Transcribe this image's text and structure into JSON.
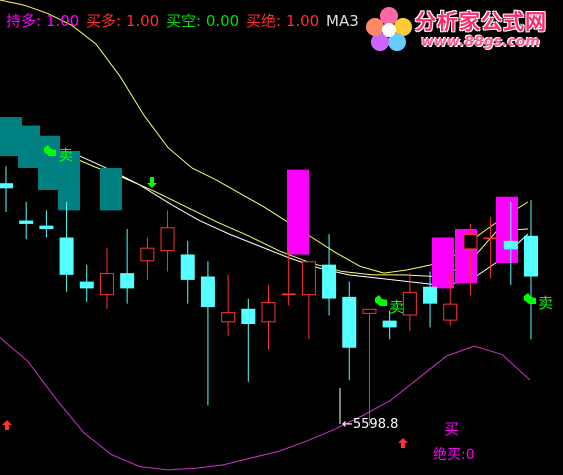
{
  "header": {
    "items": [
      {
        "label": "持多:",
        "value": "1.00",
        "color": "#ff00ff"
      },
      {
        "label": "买多:",
        "value": "1.00",
        "color": "#ff3030"
      },
      {
        "label": "买空:",
        "value": "0.00",
        "color": "#00e000"
      },
      {
        "label": "买绝:",
        "value": "1.00",
        "color": "#ff3030"
      },
      {
        "label": "MA3",
        "value": "",
        "color": "#e0e0e0"
      }
    ]
  },
  "logo": {
    "brand": "分析家公式网",
    "url": "www.88gs.com"
  },
  "colors": {
    "up": "#ff3333",
    "down": "#54ffff",
    "ma": "#ffff66",
    "mabig": "#ffffff",
    "lower": "#cc33cc",
    "blockTeal": "#008080",
    "blockMagenta": "#ff00ff",
    "sell": "#00ff00",
    "buyArrow": "#ff3333"
  },
  "chart_data": {
    "type": "candlestick",
    "y_range": [
      5570,
      5850
    ],
    "candles": [
      {
        "o": 5742,
        "h": 5752,
        "l": 5725,
        "c": 5739
      },
      {
        "o": 5720,
        "h": 5731,
        "l": 5709,
        "c": 5718
      },
      {
        "o": 5717,
        "h": 5726,
        "l": 5710,
        "c": 5715
      },
      {
        "o": 5710,
        "h": 5731,
        "l": 5678,
        "c": 5688
      },
      {
        "o": 5684,
        "h": 5694,
        "l": 5672,
        "c": 5680
      },
      {
        "o": 5676,
        "h": 5704,
        "l": 5668,
        "c": 5689
      },
      {
        "o": 5689,
        "h": 5715,
        "l": 5671,
        "c": 5680
      },
      {
        "o": 5696,
        "h": 5710,
        "l": 5685,
        "c": 5704
      },
      {
        "o": 5702,
        "h": 5726,
        "l": 5690,
        "c": 5716
      },
      {
        "o": 5700,
        "h": 5708,
        "l": 5671,
        "c": 5685
      },
      {
        "o": 5687,
        "h": 5696,
        "l": 5611,
        "c": 5669
      },
      {
        "o": 5660,
        "h": 5688,
        "l": 5652,
        "c": 5666
      },
      {
        "o": 5668,
        "h": 5674,
        "l": 5625,
        "c": 5659
      },
      {
        "o": 5660,
        "h": 5682,
        "l": 5644,
        "c": 5672
      },
      {
        "o": 5676,
        "h": 5703,
        "l": 5670,
        "c": 5677
      },
      {
        "o": 5676,
        "h": 5692,
        "l": 5650,
        "c": 5696
      },
      {
        "o": 5694,
        "h": 5712,
        "l": 5664,
        "c": 5674
      },
      {
        "o": 5675,
        "h": 5684,
        "l": 5626,
        "c": 5645
      },
      {
        "o": 5665,
        "h": 5668,
        "l": 5599,
        "c": 5668
      },
      {
        "o": 5661,
        "h": 5667,
        "l": 5650,
        "c": 5657
      },
      {
        "o": 5664,
        "h": 5689,
        "l": 5655,
        "c": 5678
      },
      {
        "o": 5681,
        "h": 5690,
        "l": 5657,
        "c": 5671
      },
      {
        "o": 5661,
        "h": 5690,
        "l": 5658,
        "c": 5671
      },
      {
        "o": 5703,
        "h": 5718,
        "l": 5676,
        "c": 5712
      },
      {
        "o": 5710,
        "h": 5722,
        "l": 5686,
        "c": 5710
      },
      {
        "o": 5708,
        "h": 5731,
        "l": 5682,
        "c": 5703
      },
      {
        "o": 5711,
        "h": 5732,
        "l": 5650,
        "c": 5687
      }
    ],
    "blocks_teal": [
      {
        "from": 5781,
        "to": 5758
      },
      {
        "from": 5776,
        "to": 5751
      },
      {
        "from": 5770,
        "to": 5738
      },
      {
        "from": 5761,
        "to": 5726
      },
      {
        "from": 5751,
        "to": 5726
      }
    ],
    "blocks_magenta": [
      {
        "from": 5750,
        "to": 5700
      },
      {
        "from": 5710,
        "to": 5680
      },
      {
        "from": 5715,
        "to": 5683
      },
      {
        "from": 5734,
        "to": 5695
      }
    ],
    "ma_upper": [
      5850,
      5847,
      5842,
      5835,
      5824,
      5805,
      5782,
      5763,
      5751,
      5744,
      5736,
      5728,
      5719,
      5710,
      5701,
      5693,
      5689,
      5691,
      5694,
      5700,
      5712,
      5722,
      5731
    ],
    "ma_mid": [
      5770,
      5766,
      5760,
      5752,
      5745,
      5737,
      5728,
      5719,
      5711,
      5702,
      5695,
      5690,
      5688,
      5688,
      5687,
      5693,
      5714,
      5715
    ],
    "ma_low": [
      5758,
      5750,
      5741,
      5730,
      5720,
      5712,
      5705,
      5698,
      5692,
      5688,
      5686,
      5684,
      5682,
      5684,
      5696,
      5712
    ],
    "lower_line": [
      5651,
      5637,
      5615,
      5595,
      5582,
      5575,
      5573,
      5574,
      5576,
      5580,
      5584,
      5590,
      5597,
      5605,
      5614,
      5627,
      5640,
      5646,
      5641,
      5626
    ],
    "annotations": {
      "sell_label": "卖",
      "buy_label": "买",
      "low_price": "5598.8",
      "juemai": "绝买:0"
    }
  }
}
